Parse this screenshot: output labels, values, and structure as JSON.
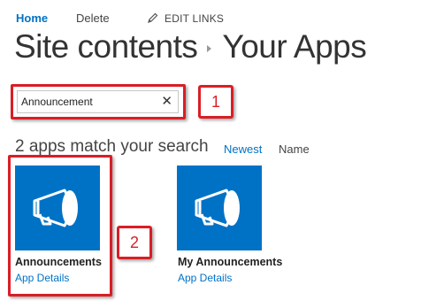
{
  "nav": {
    "home": "Home",
    "delete": "Delete",
    "edit_links": "EDIT LINKS"
  },
  "heading": {
    "site_contents": "Site contents",
    "your_apps": "Your Apps"
  },
  "search": {
    "value": "Announcement",
    "clear_icon": "close-icon"
  },
  "callouts": {
    "one": "1",
    "two": "2"
  },
  "results": {
    "count_text": "2 apps match your search",
    "sort_newest": "Newest",
    "sort_name": "Name"
  },
  "apps": [
    {
      "name": "Announcements",
      "details": "App Details",
      "icon": "megaphone-icon"
    },
    {
      "name": "My Announcements",
      "details": "App Details",
      "icon": "megaphone-icon"
    }
  ],
  "colors": {
    "accent": "#0072c6",
    "tile": "#0072c6",
    "annotation": "#d91e26"
  }
}
